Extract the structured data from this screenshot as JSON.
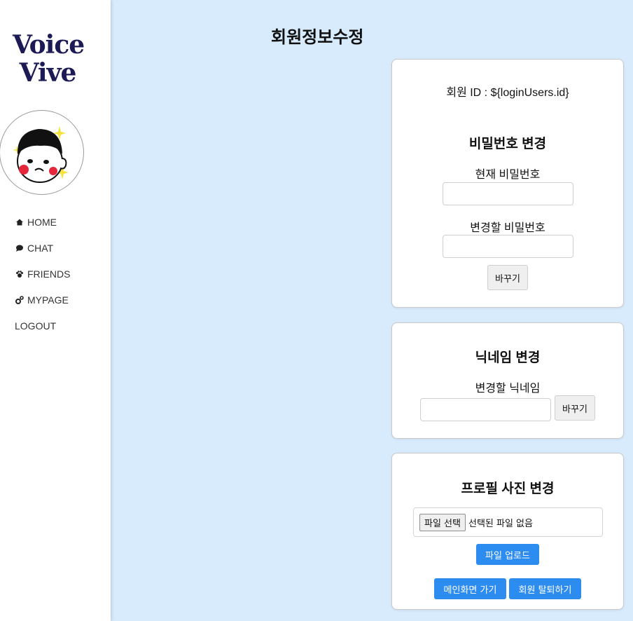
{
  "sidebar": {
    "logo_line1": "Voice",
    "logo_line2": "Vive",
    "nav": [
      {
        "label": "HOME",
        "icon": "home-icon"
      },
      {
        "label": "CHAT",
        "icon": "chat-icon"
      },
      {
        "label": "FRIENDS",
        "icon": "friends-icon"
      },
      {
        "label": "MYPAGE",
        "icon": "gears-icon"
      },
      {
        "label": "LOGOUT",
        "icon": ""
      }
    ]
  },
  "main": {
    "title": "회원정보수정"
  },
  "password_card": {
    "member_id": "회원 ID : ${loginUsers.id}",
    "heading": "비밀번호 변경",
    "current_label": "현재 비밀번호",
    "new_label": "변경할 비밀번호",
    "submit_label": "바꾸기"
  },
  "nickname_card": {
    "heading": "닉네임 변경",
    "new_label": "변경할 닉네임",
    "submit_label": "바꾸기"
  },
  "profile_card": {
    "heading": "프로필 사진 변경",
    "file_button_label": "파일 선택",
    "file_status": "선택된 파일 없음",
    "upload_label": "파일 업로드",
    "main_label": "메인화면 가기",
    "withdraw_label": "회원 탈퇴하기"
  },
  "colors": {
    "background": "#d8ebfd",
    "logo": "#1c1b55",
    "accent_button": "#2d8cf0"
  }
}
